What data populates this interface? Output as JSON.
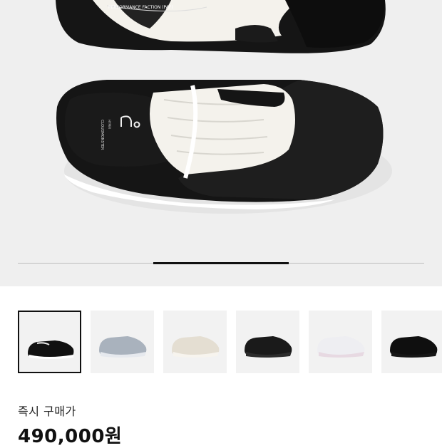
{
  "gallery": {
    "hero_alt": "black and white sneakers top view",
    "progress_fraction": 0.3,
    "progress_start_fraction": 0.33,
    "hero_texts": {
      "insole_brand": "CLOUDMONSTER",
      "insole_sub": "HYPER",
      "tongue_top": "PERFORMANCE FACTION (PAF)"
    },
    "thumbnails": [
      {
        "selected": true,
        "colorway": "black-white"
      },
      {
        "selected": false,
        "colorway": "silver"
      },
      {
        "selected": false,
        "colorway": "cream"
      },
      {
        "selected": false,
        "colorway": "black"
      },
      {
        "selected": false,
        "colorway": "white-pink"
      },
      {
        "selected": false,
        "colorway": "all-black"
      }
    ]
  },
  "purchase": {
    "label": "즉시 구매가",
    "price": "490,000원"
  },
  "colors": {
    "hero_bg": "#efefef",
    "thumb_bg": "#f2f2f2",
    "selected_border": "#111111"
  }
}
